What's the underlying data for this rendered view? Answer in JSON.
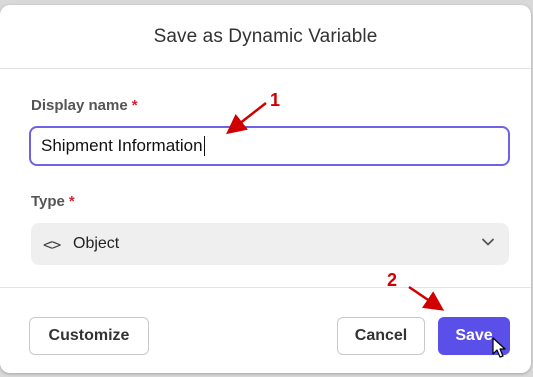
{
  "dialog": {
    "title": "Save as Dynamic Variable"
  },
  "display_name": {
    "label": "Display name",
    "required_mark": "*",
    "value": "Shipment Information"
  },
  "type_field": {
    "label": "Type",
    "required_mark": "*",
    "icon": "code-icon",
    "icon_glyph": "<>",
    "selected": "Object"
  },
  "footer": {
    "customize_label": "Customize",
    "cancel_label": "Cancel",
    "save_label": "Save"
  },
  "annotations": {
    "step1": "1",
    "step2": "2",
    "color": "#d10000"
  },
  "colors": {
    "accent": "#5b4fe9",
    "input_border": "#6e62e6",
    "required": "#d1242f"
  }
}
